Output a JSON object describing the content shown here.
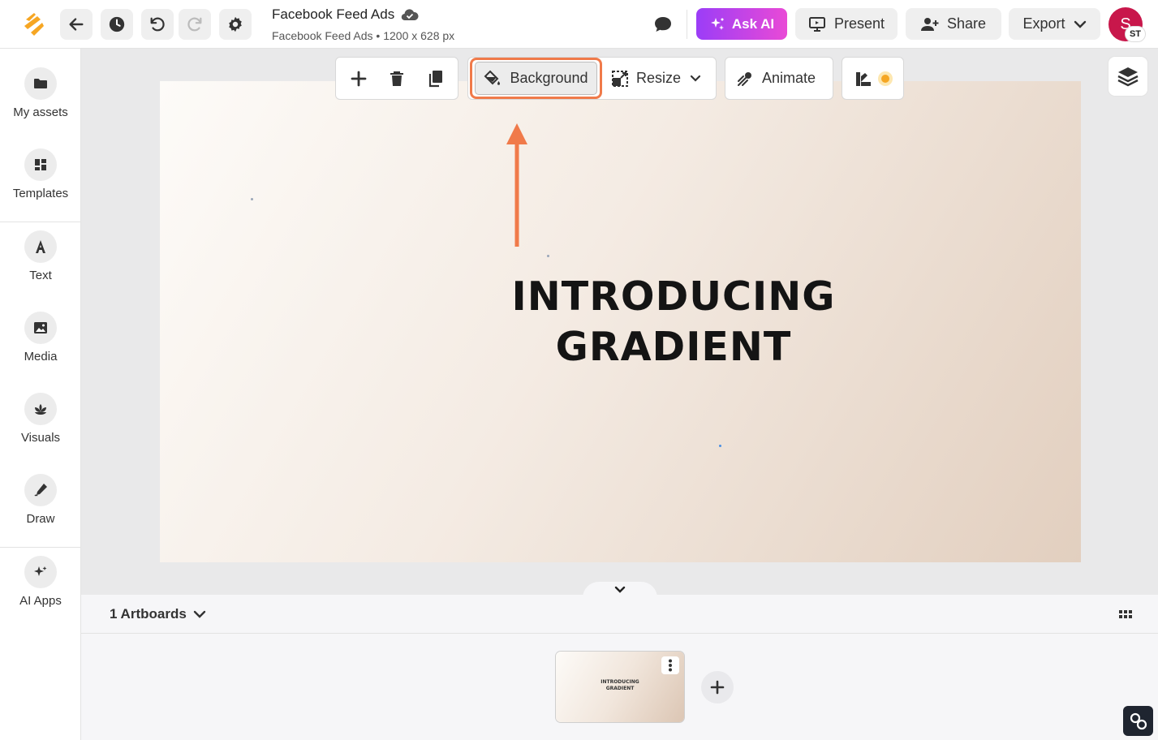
{
  "header": {
    "doc_title": "Facebook Feed Ads",
    "doc_subtitle": "Facebook Feed Ads • 1200 x 628 px",
    "ask_ai_label": "Ask AI",
    "present_label": "Present",
    "share_label": "Share",
    "export_label": "Export",
    "avatar_initial": "S",
    "avatar_badge": "ST"
  },
  "sidebar": {
    "items": [
      {
        "label": "My assets",
        "icon": "folder-icon"
      },
      {
        "label": "Templates",
        "icon": "templates-icon"
      },
      {
        "label": "Text",
        "icon": "text-icon"
      },
      {
        "label": "Media",
        "icon": "image-icon"
      },
      {
        "label": "Visuals",
        "icon": "lotus-icon"
      },
      {
        "label": "Draw",
        "icon": "pen-icon"
      },
      {
        "label": "AI Apps",
        "icon": "sparkle-icon"
      }
    ]
  },
  "toolbar": {
    "background_label": "Background",
    "resize_label": "Resize",
    "animate_label": "Animate"
  },
  "canvas": {
    "headline_line1": "INTRODUCING",
    "headline_line2": "GRADIENT"
  },
  "bottom": {
    "artboards_label": "1 Artboards",
    "thumb_line1": "INTRODUCING",
    "thumb_line2": "GRADIENT"
  },
  "colors": {
    "accent_orange": "#f07a4a",
    "ai_gradient_start": "#9b3df7",
    "ai_gradient_end": "#e94ad6",
    "avatar": "#c8174b"
  }
}
